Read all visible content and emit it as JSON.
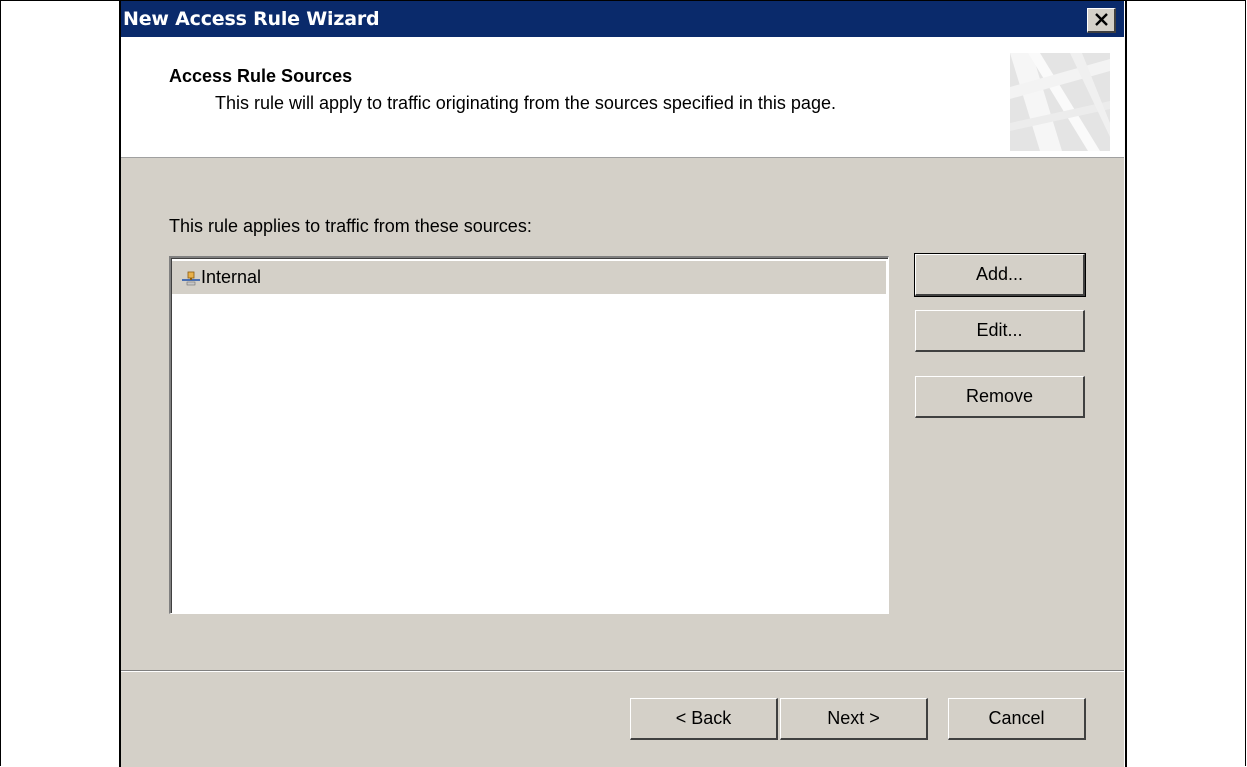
{
  "window": {
    "title": "New Access Rule Wizard"
  },
  "header": {
    "title": "Access Rule Sources",
    "subtitle": "This rule will apply to traffic originating from the sources specified in this page."
  },
  "sources": {
    "label": "This rule applies to traffic from these sources:",
    "items": [
      {
        "label": "Internal",
        "icon": "network-icon",
        "selected": true
      }
    ]
  },
  "side_buttons": {
    "add": "Add...",
    "edit": "Edit...",
    "remove": "Remove"
  },
  "footer_buttons": {
    "back": "< Back",
    "next": "Next >",
    "cancel": "Cancel"
  },
  "colors": {
    "titlebar": "#0a2a6b",
    "dialog_bg": "#d4d0c8",
    "header_bg": "#ffffff",
    "selection_bg": "#d4d0c8"
  }
}
